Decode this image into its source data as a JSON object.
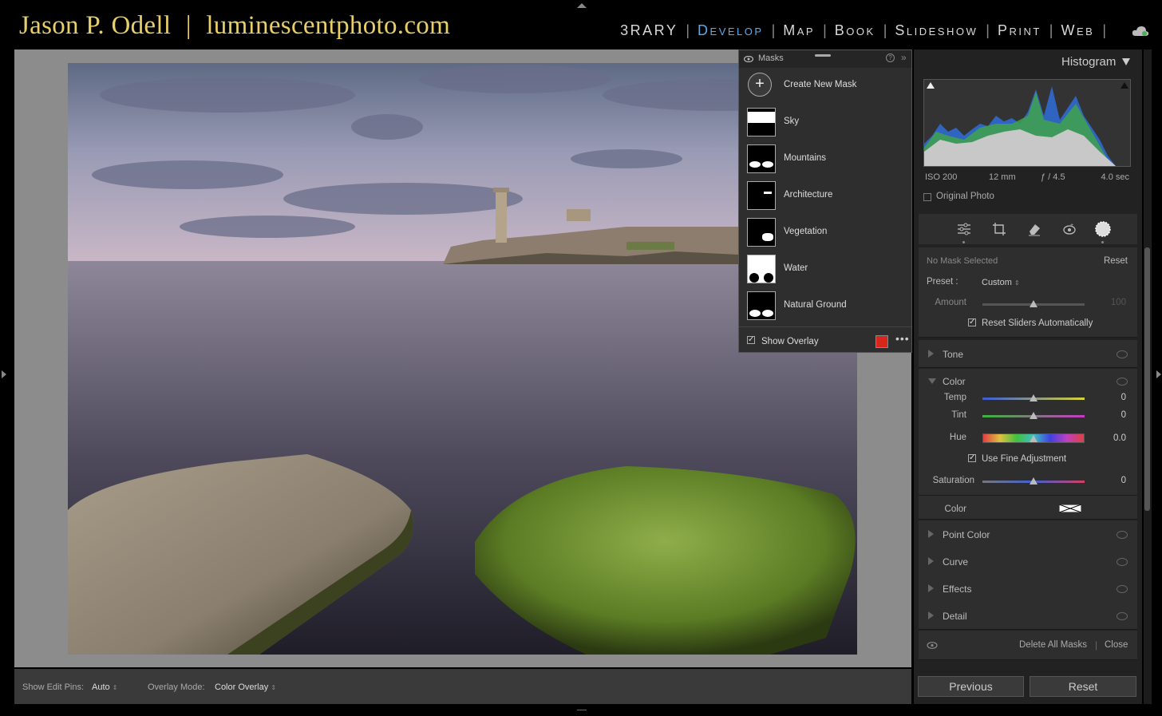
{
  "brand": {
    "name": "Jason P. Odell",
    "separator": "|",
    "site": "luminescentphoto.com"
  },
  "modules": [
    {
      "label": "3RARY",
      "active": false
    },
    {
      "label": "Develop",
      "active": true
    },
    {
      "label": "Map",
      "active": false
    },
    {
      "label": "Book",
      "active": false
    },
    {
      "label": "Slideshow",
      "active": false
    },
    {
      "label": "Print",
      "active": false
    },
    {
      "label": "Web",
      "active": false
    }
  ],
  "masks_panel": {
    "title": "Masks",
    "create_label": "Create New Mask",
    "items": [
      {
        "label": "Sky",
        "icon": "sky-mask-thumb"
      },
      {
        "label": "Mountains",
        "icon": "mountains-mask-thumb"
      },
      {
        "label": "Architecture",
        "icon": "architecture-mask-thumb"
      },
      {
        "label": "Vegetation",
        "icon": "vegetation-mask-thumb"
      },
      {
        "label": "Water",
        "icon": "water-mask-thumb"
      },
      {
        "label": "Natural Ground",
        "icon": "natural-ground-mask-thumb"
      }
    ],
    "show_overlay_label": "Show Overlay",
    "overlay_color": "#d9261c"
  },
  "histogram": {
    "title": "Histogram",
    "iso": "ISO 200",
    "focal": "12 mm",
    "aperture": "ƒ / 4.5",
    "shutter": "4.0 sec",
    "original_photo_label": "Original Photo"
  },
  "mask_settings": {
    "no_mask": "No Mask Selected",
    "reset": "Reset",
    "preset_label": "Preset :",
    "preset_value": "Custom",
    "amount_label": "Amount",
    "amount_value": "100",
    "reset_sliders_label": "Reset Sliders Automatically"
  },
  "sections": {
    "tone": "Tone",
    "color": "Color",
    "point_color": "Point Color",
    "curve": "Curve",
    "effects": "Effects",
    "detail": "Detail"
  },
  "color_section": {
    "temp_label": "Temp",
    "temp_value": "0",
    "tint_label": "Tint",
    "tint_value": "0",
    "hue_label": "Hue",
    "hue_value": "0.0",
    "fine_adjust_label": "Use Fine Adjustment",
    "saturation_label": "Saturation",
    "saturation_value": "0",
    "color_label": "Color"
  },
  "mask_footer": {
    "delete_all": "Delete All Masks",
    "close": "Close"
  },
  "buttons": {
    "previous": "Previous",
    "reset": "Reset"
  },
  "bottombar": {
    "edit_pins_label": "Show Edit Pins:",
    "edit_pins_value": "Auto",
    "overlay_mode_label": "Overlay Mode:",
    "overlay_mode_value": "Color Overlay"
  }
}
